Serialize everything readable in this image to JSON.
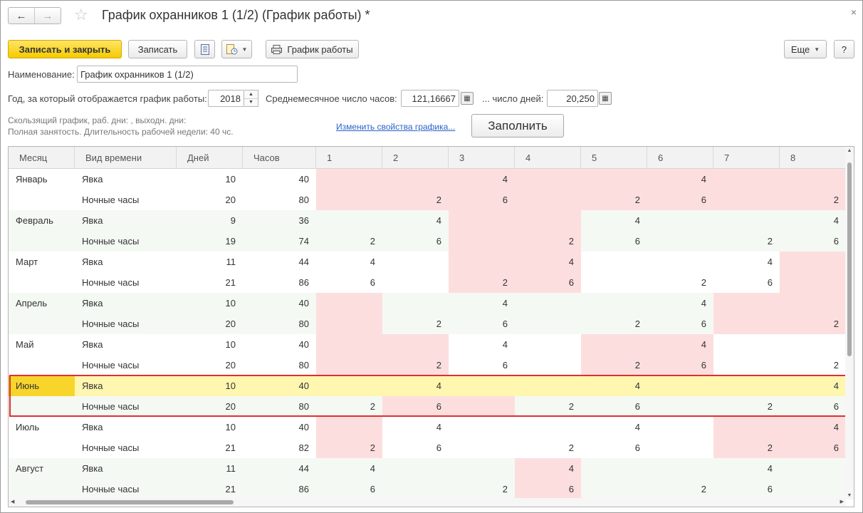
{
  "window": {
    "title": "График охранников 1 (1/2) (График работы) *",
    "back_glyph": "←",
    "fwd_glyph": "→",
    "star_glyph": "☆",
    "close_glyph": "×"
  },
  "toolbar": {
    "save_close": "Записать и закрыть",
    "save": "Записать",
    "print_schedule": "График работы",
    "more": "Еще",
    "help": "?"
  },
  "form": {
    "name_label": "Наименование:",
    "name_value": "График охранников 1 (1/2)",
    "year_label": "Год, за который отображается график работы:",
    "year_value": "2018",
    "avg_hours_label": "Среднемесячное число часов:",
    "avg_hours_value": "121,16667",
    "avg_days_label": "... число дней:",
    "avg_days_value": "20,250",
    "info_line1": "Скользящий график, раб. дни: , выходн. дни:",
    "info_line2": "Полная занятость. Длительность рабочей недели: 40 чс.",
    "change_link": "Изменить свойства графика...",
    "fill_button": "Заполнить"
  },
  "table": {
    "headers": [
      "Месяц",
      "Вид времени",
      "Дней",
      "Часов",
      "1",
      "2",
      "3",
      "4",
      "5",
      "6",
      "7",
      "8"
    ],
    "rows": [
      {
        "month": "Январь",
        "kind": "Явка",
        "days": "10",
        "hours": "40",
        "d": [
          "",
          "",
          "4",
          "",
          "",
          "4",
          "",
          ""
        ],
        "pink": [
          1,
          1,
          1,
          1,
          1,
          1,
          1,
          1
        ],
        "zebra": false,
        "hl": false
      },
      {
        "month": "",
        "kind": "Ночные часы",
        "days": "20",
        "hours": "80",
        "d": [
          "",
          "2",
          "6",
          "",
          "2",
          "6",
          "",
          "2"
        ],
        "pink": [
          1,
          1,
          1,
          1,
          1,
          1,
          1,
          1
        ],
        "zebra": false,
        "hl": false
      },
      {
        "month": "Февраль",
        "kind": "Явка",
        "days": "9",
        "hours": "36",
        "d": [
          "",
          "4",
          "",
          "",
          "4",
          "",
          "",
          "4"
        ],
        "pink": [
          0,
          0,
          1,
          1,
          0,
          0,
          0,
          0
        ],
        "zebra": true,
        "hl": false
      },
      {
        "month": "",
        "kind": "Ночные часы",
        "days": "19",
        "hours": "74",
        "d": [
          "2",
          "6",
          "",
          "2",
          "6",
          "",
          "2",
          "6"
        ],
        "pink": [
          0,
          0,
          1,
          1,
          0,
          0,
          0,
          0
        ],
        "zebra": true,
        "hl": false
      },
      {
        "month": "Март",
        "kind": "Явка",
        "days": "11",
        "hours": "44",
        "d": [
          "4",
          "",
          "",
          "4",
          "",
          "",
          "4",
          ""
        ],
        "pink": [
          0,
          0,
          1,
          1,
          0,
          0,
          0,
          1
        ],
        "zebra": false,
        "hl": false
      },
      {
        "month": "",
        "kind": "Ночные часы",
        "days": "21",
        "hours": "86",
        "d": [
          "6",
          "",
          "2",
          "6",
          "",
          "2",
          "6",
          ""
        ],
        "pink": [
          0,
          0,
          1,
          1,
          0,
          0,
          0,
          1
        ],
        "zebra": false,
        "hl": false
      },
      {
        "month": "Апрель",
        "kind": "Явка",
        "days": "10",
        "hours": "40",
        "d": [
          "",
          "",
          "4",
          "",
          "",
          "4",
          "",
          ""
        ],
        "pink": [
          1,
          0,
          0,
          0,
          0,
          0,
          1,
          1
        ],
        "zebra": true,
        "hl": false
      },
      {
        "month": "",
        "kind": "Ночные часы",
        "days": "20",
        "hours": "80",
        "d": [
          "",
          "2",
          "6",
          "",
          "2",
          "6",
          "",
          "2"
        ],
        "pink": [
          1,
          0,
          0,
          0,
          0,
          0,
          1,
          1
        ],
        "zebra": true,
        "hl": false
      },
      {
        "month": "Май",
        "kind": "Явка",
        "days": "10",
        "hours": "40",
        "d": [
          "",
          "",
          "4",
          "",
          "",
          "4",
          "",
          ""
        ],
        "pink": [
          1,
          1,
          0,
          0,
          1,
          1,
          0,
          0
        ],
        "zebra": false,
        "hl": false
      },
      {
        "month": "",
        "kind": "Ночные часы",
        "days": "20",
        "hours": "80",
        "d": [
          "",
          "2",
          "6",
          "",
          "2",
          "6",
          "",
          "2"
        ],
        "pink": [
          1,
          1,
          0,
          0,
          1,
          1,
          0,
          0
        ],
        "zebra": false,
        "hl": false
      },
      {
        "month": "Июнь",
        "kind": "Явка",
        "days": "10",
        "hours": "40",
        "d": [
          "",
          "4",
          "",
          "",
          "4",
          "",
          "",
          "4"
        ],
        "pink": [
          0,
          0,
          0,
          0,
          0,
          0,
          0,
          0
        ],
        "zebra": true,
        "hl": true
      },
      {
        "month": "",
        "kind": "Ночные часы",
        "days": "20",
        "hours": "80",
        "d": [
          "2",
          "6",
          "",
          "2",
          "6",
          "",
          "2",
          "6"
        ],
        "pink": [
          0,
          1,
          1,
          0,
          0,
          0,
          0,
          0
        ],
        "zebra": true,
        "hl": false
      },
      {
        "month": "Июль",
        "kind": "Явка",
        "days": "10",
        "hours": "40",
        "d": [
          "",
          "4",
          "",
          "",
          "4",
          "",
          "",
          "4"
        ],
        "pink": [
          1,
          0,
          0,
          0,
          0,
          0,
          1,
          1
        ],
        "zebra": false,
        "hl": false
      },
      {
        "month": "",
        "kind": "Ночные часы",
        "days": "21",
        "hours": "82",
        "d": [
          "2",
          "6",
          "",
          "2",
          "6",
          "",
          "2",
          "6"
        ],
        "pink": [
          1,
          0,
          0,
          0,
          0,
          0,
          1,
          1
        ],
        "zebra": false,
        "hl": false
      },
      {
        "month": "Август",
        "kind": "Явка",
        "days": "11",
        "hours": "44",
        "d": [
          "4",
          "",
          "",
          "4",
          "",
          "",
          "4",
          ""
        ],
        "pink": [
          0,
          0,
          0,
          1,
          0,
          0,
          0,
          0
        ],
        "zebra": true,
        "hl": false
      },
      {
        "month": "",
        "kind": "Ночные часы",
        "days": "21",
        "hours": "86",
        "d": [
          "6",
          "",
          "2",
          "6",
          "",
          "2",
          "6",
          ""
        ],
        "pink": [
          0,
          0,
          0,
          1,
          0,
          0,
          0,
          0
        ],
        "zebra": true,
        "hl": false
      }
    ]
  }
}
